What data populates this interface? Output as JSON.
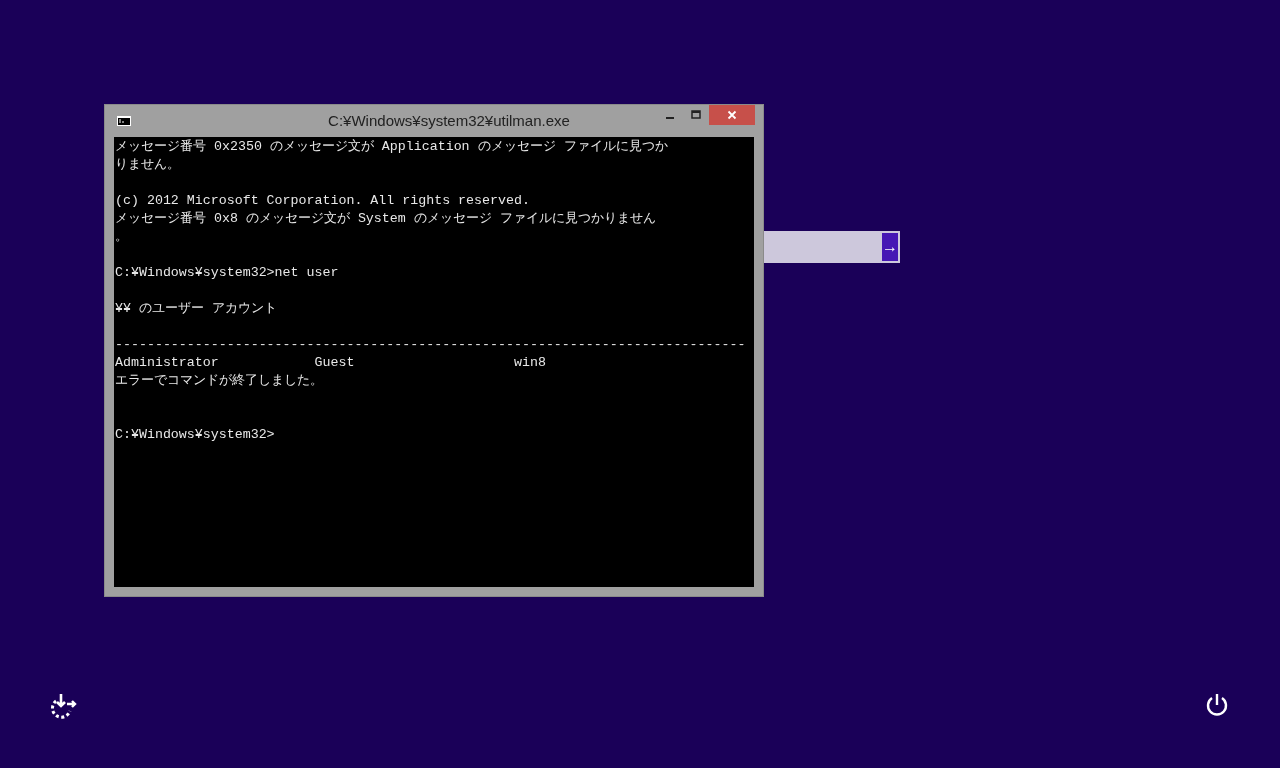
{
  "login": {
    "submit_label": "→"
  },
  "window": {
    "title": "C:¥Windows¥system32¥utilman.exe"
  },
  "console": {
    "blocks": [
      [
        "メッセージ番号 0x2350 のメッセージ文が Application のメッセージ ファイルに見つか",
        "りません。"
      ],
      [
        "(c) 2012 Microsoft Corporation. All rights reserved.",
        "メッセージ番号 0x8 のメッセージ文が System のメッセージ ファイルに見つかりません",
        "。"
      ],
      [
        "C:¥Windows¥system32>net user"
      ],
      [
        "¥¥ のユーザー アカウント"
      ],
      [
        "-------------------------------------------------------------------------------",
        "Administrator            Guest                    win8",
        "エラーでコマンドが終了しました。"
      ],
      [
        "C:¥Windows¥system32>"
      ]
    ]
  }
}
